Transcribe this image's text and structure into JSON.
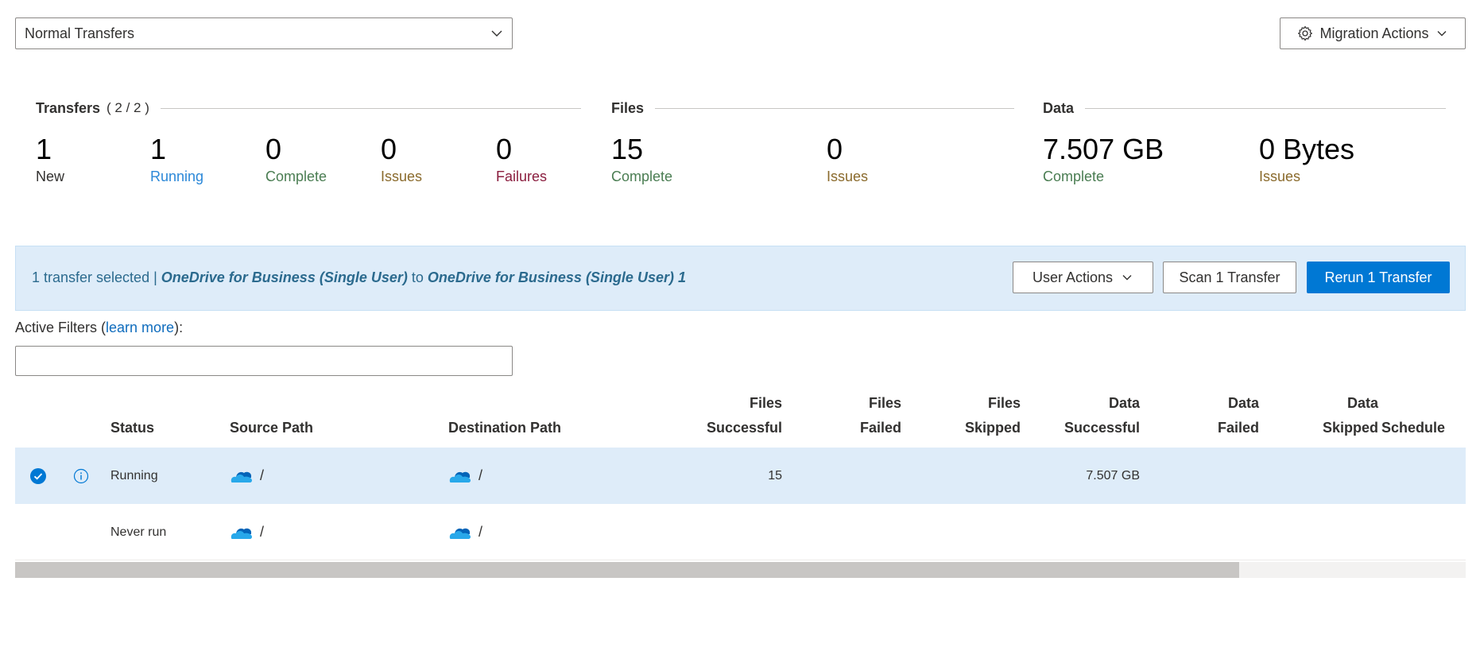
{
  "view_select": {
    "value": "Normal Transfers"
  },
  "migration_actions": {
    "label": "Migration Actions"
  },
  "summary": {
    "transfers": {
      "title": "Transfers",
      "count": "( 2 / 2 )",
      "stats": [
        {
          "value": "1",
          "label": "New",
          "color": "#323130"
        },
        {
          "value": "1",
          "label": "Running",
          "color": "#2b88d8"
        },
        {
          "value": "0",
          "label": "Complete",
          "color": "#4a7d52"
        },
        {
          "value": "0",
          "label": "Issues",
          "color": "#8a6a2c"
        },
        {
          "value": "0",
          "label": "Failures",
          "color": "#8b1e3f"
        }
      ]
    },
    "files": {
      "title": "Files",
      "stats": [
        {
          "value": "15",
          "label": "Complete",
          "color": "#4a7d52"
        },
        {
          "value": "0",
          "label": "Issues",
          "color": "#8a6a2c"
        }
      ]
    },
    "data": {
      "title": "Data",
      "stats": [
        {
          "value": "7.507 GB",
          "label": "Complete",
          "color": "#4a7d52"
        },
        {
          "value": "0 Bytes",
          "label": "Issues",
          "color": "#8a6a2c"
        }
      ]
    }
  },
  "selection_bar": {
    "prefix": "1 transfer selected | ",
    "source": "OneDrive for Business (Single User)",
    "joiner": " to ",
    "destination": "OneDrive for Business (Single User) 1",
    "user_actions_label": "User Actions",
    "scan_label": "Scan 1 Transfer",
    "rerun_label": "Rerun 1 Transfer"
  },
  "filters": {
    "label": "Active Filters",
    "open_paren": " (",
    "learn_more": "learn more",
    "close": "):",
    "value": ""
  },
  "table": {
    "headers": {
      "status": "Status",
      "source_path": "Source Path",
      "destination_path": "Destination Path",
      "files_successful_1": "Files",
      "files_successful_2": "Successful",
      "files_failed_1": "Files",
      "files_failed_2": "Failed",
      "files_skipped_1": "Files",
      "files_skipped_2": "Skipped",
      "data_successful_1": "Data",
      "data_successful_2": "Successful",
      "data_failed_1": "Data",
      "data_failed_2": "Failed",
      "data_skipped_1": "Data",
      "data_skipped_2": "Skipped",
      "schedule": "Schedule"
    },
    "rows": [
      {
        "selected": true,
        "status": "Running",
        "source_path": "/",
        "destination_path": "/",
        "files_successful": "15",
        "files_failed": "",
        "files_skipped": "",
        "data_successful": "7.507 GB",
        "data_failed": "",
        "data_skipped": "",
        "schedule": ""
      },
      {
        "selected": false,
        "status": "Never run",
        "source_path": "/",
        "destination_path": "/",
        "files_successful": "",
        "files_failed": "",
        "files_skipped": "",
        "data_successful": "",
        "data_failed": "",
        "data_skipped": "",
        "schedule": ""
      }
    ]
  },
  "colors": {
    "accent": "#0078d4",
    "selection_bg": "#deecf9",
    "cloud_dark": "#0364b8",
    "cloud_light": "#28a8ea"
  },
  "icons": {
    "view_select": "chevron-down-icon",
    "migration_actions": "gear-icon",
    "row_select": "check-circle-icon",
    "row_info": "info-icon",
    "path": "onedrive-cloud-icon"
  }
}
